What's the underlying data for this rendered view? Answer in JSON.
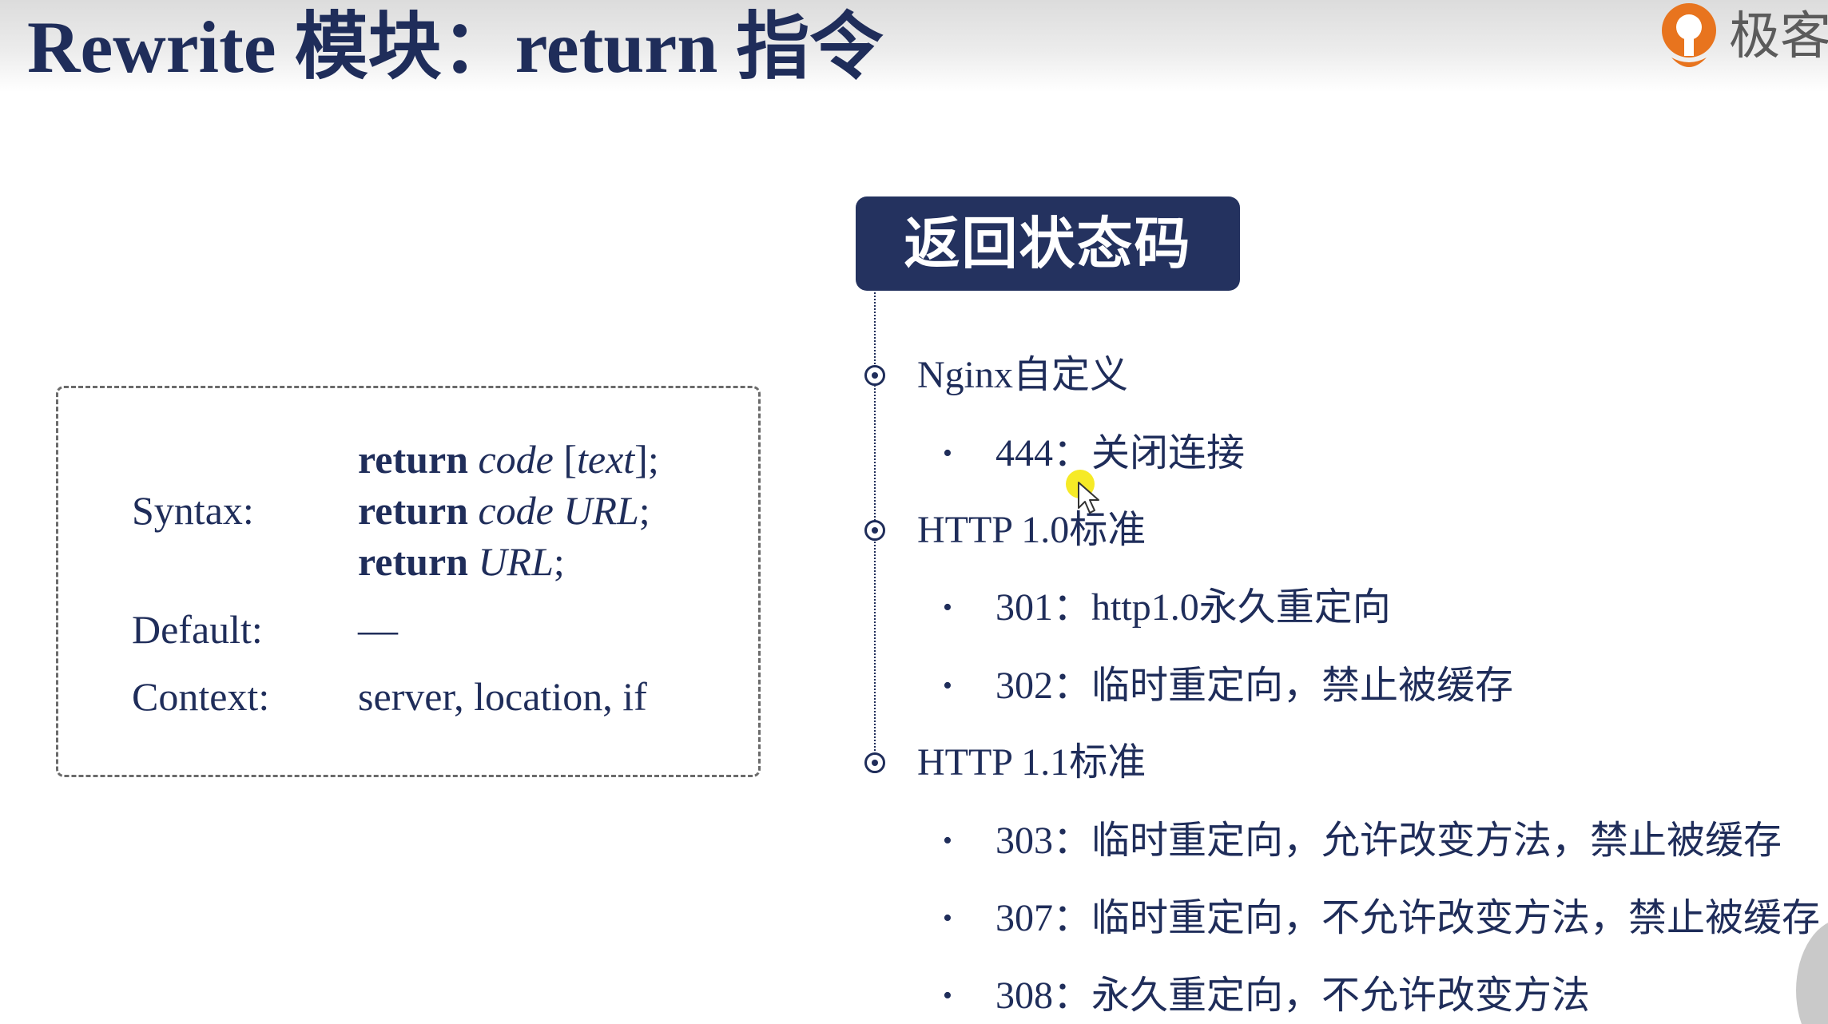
{
  "slide": {
    "title": "Rewrite 模块：return 指令",
    "logo_text": "极客",
    "colors": {
      "primary": "#1f2d5a",
      "pill_background": "#24325f",
      "logo_orange": "#e8741e",
      "cursor_highlight": "#f5e600"
    }
  },
  "syntax_box": {
    "syntax_label": "Syntax:",
    "syntax_lines": [
      {
        "keyword": "return",
        "args_italic": "code",
        "rest_plain": " [",
        "rest_italic": "text",
        "tail": "];"
      },
      {
        "keyword": "return",
        "args_italic": "code URL",
        "tail": ";"
      },
      {
        "keyword": "return",
        "args_italic": "URL",
        "tail": ";"
      }
    ],
    "default_label": "Default:",
    "default_value": "—",
    "context_label": "Context:",
    "context_value": "server, location, if"
  },
  "status_codes": {
    "header": "返回状态码",
    "groups": [
      {
        "category": "Nginx自定义",
        "items": [
          {
            "code": "444",
            "sep": "：",
            "desc": "关闭连接"
          }
        ]
      },
      {
        "category": "HTTP 1.0标准",
        "items": [
          {
            "code": "301",
            "sep": "：",
            "desc": "http1.0永久重定向"
          },
          {
            "code": "302",
            "sep": "：",
            "desc": "临时重定向，禁止被缓存"
          }
        ]
      },
      {
        "category": "HTTP 1.1标准",
        "items": [
          {
            "code": "303",
            "sep": "：",
            "desc": "临时重定向，允许改变方法，禁止被缓存"
          },
          {
            "code": "307",
            "sep": "：",
            "desc": "临时重定向，不允许改变方法，禁止被缓存"
          },
          {
            "code": "308",
            "sep": "：",
            "desc": "永久重定向，不允许改变方法"
          }
        ]
      }
    ]
  },
  "icons": {
    "logo": "geektime-logo-icon",
    "cursor": "mouse-cursor-icon",
    "bullet": "•"
  }
}
